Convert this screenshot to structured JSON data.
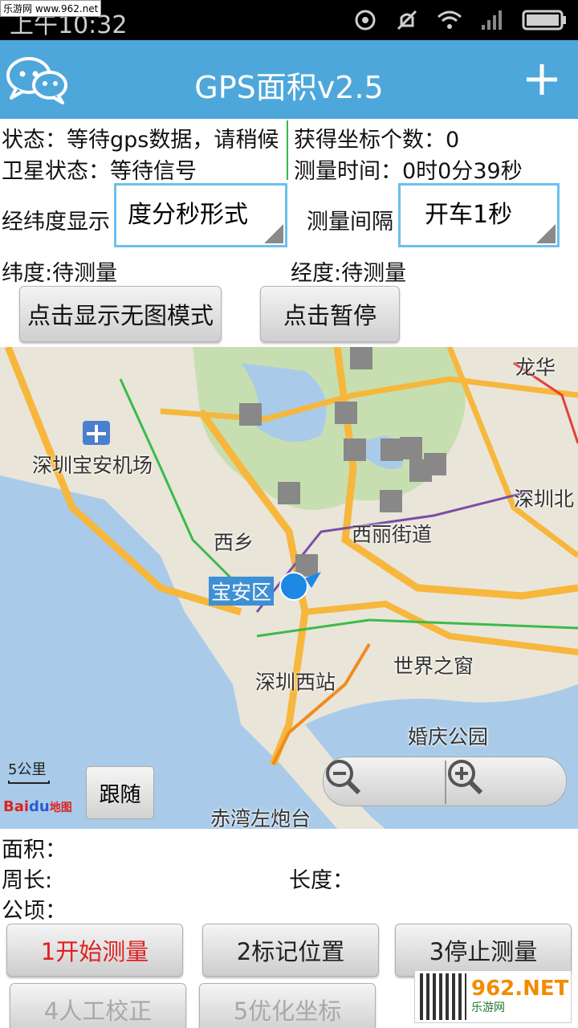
{
  "status_bar": {
    "time": "上午10:32",
    "watermark": "乐游网 www.962.net",
    "icons": [
      "sync-icon",
      "mute-icon",
      "wifi-icon",
      "signal-icon",
      "battery-icon"
    ]
  },
  "title_bar": {
    "title": "GPS面积v2.5",
    "left_icon": "wechat-icon",
    "right_icon": "plus-icon"
  },
  "info": {
    "status": "状态：等待gps数据，请稍候",
    "coord_count": "获得坐标个数：0",
    "satellite": "卫星状态：等待信号",
    "measure_time": "测量时间：0时0分39秒",
    "latlon_display_label": "经纬度显示",
    "latlon_display_value": "度分秒形式",
    "interval_label": "测量间隔",
    "interval_value": "开车1秒",
    "latitude": "纬度:待测量",
    "longitude": "经度:待测量"
  },
  "buttons_top": {
    "no_map_mode": "点击显示无图模式",
    "pause": "点击暂停"
  },
  "map": {
    "labels": {
      "longhua": "龙华",
      "airport": "深圳宝安机场",
      "shenzhen_north": "深圳北",
      "xixiang": "西乡",
      "xili": "西丽街道",
      "baoan": "宝安区",
      "window_of_world": "世界之窗",
      "shenzhen_west": "深圳西站",
      "wedding_park": "婚庆公园",
      "chiwan": "赤湾左炮台"
    },
    "scale": "5公里",
    "follow": "跟随",
    "baidu_logo": "Bai",
    "baidu_logo_du": "du",
    "baidu_logo_map": "地图",
    "colors": {
      "water": "#a9cbe9",
      "land": "#e9e5d8",
      "green": "#c7dfb0",
      "highway": "#f6b73c"
    }
  },
  "results": {
    "area": "面积：",
    "perimeter": "周长:",
    "length": "长度：",
    "hectare": "公顷："
  },
  "buttons_bottom": {
    "start": "1开始测量",
    "mark": "2标记位置",
    "stop": "3停止测量",
    "manual_correct": "4人工校正",
    "optimize": "5优化坐标"
  },
  "watermark_corner": {
    "brand": "962.NET",
    "sub": "乐游网"
  },
  "accent_color": "#4ea7db"
}
